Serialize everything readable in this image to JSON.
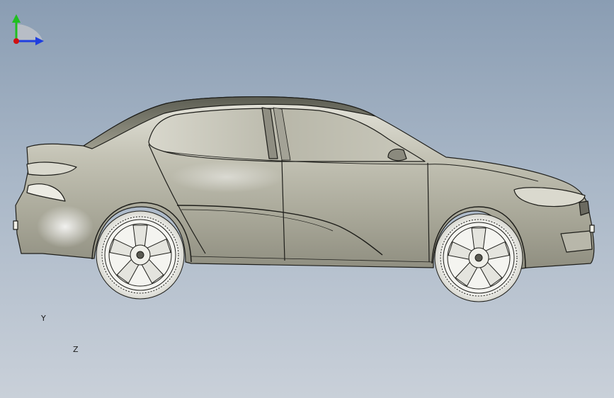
{
  "viewport": {
    "background_top": "#8a9db3",
    "background_bottom": "#c9d0d9",
    "model": "car-body",
    "wheels": 2
  },
  "triad": {
    "y_label": "Y",
    "z_label": "Z",
    "y_color": "#1fbf1f",
    "z_color": "#1f3fdf",
    "x_color": "#d01010"
  }
}
